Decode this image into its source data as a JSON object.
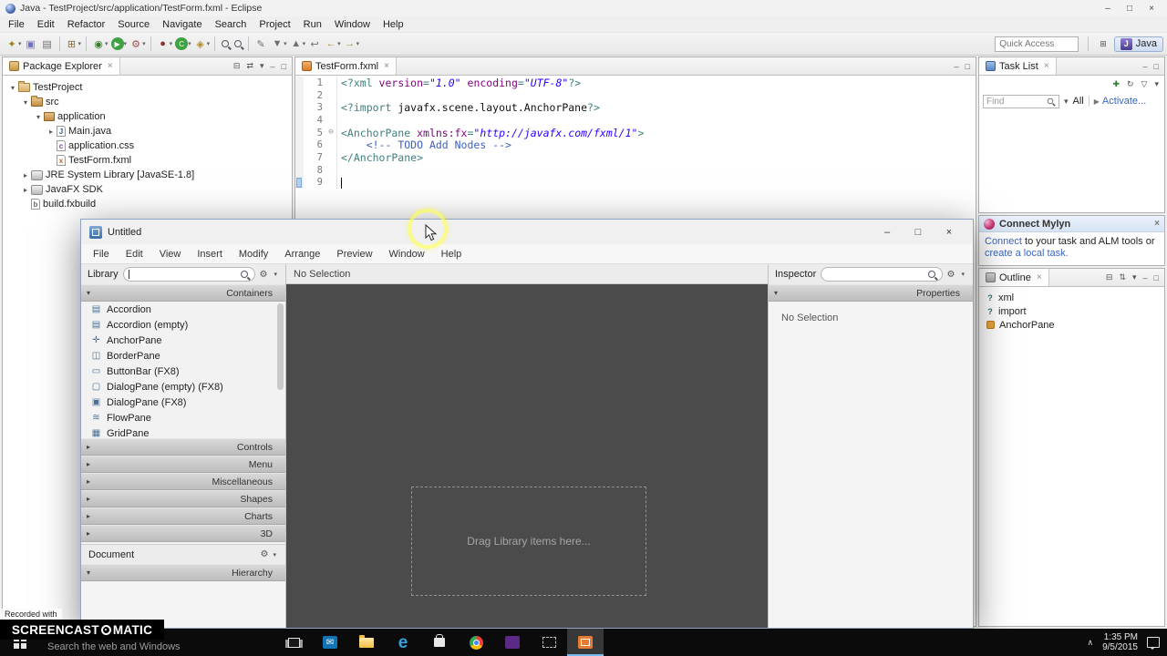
{
  "icons": {
    "close": "×",
    "minimize": "–",
    "maximize": "□",
    "chevron_down": "▾",
    "chevron_right": "▸",
    "chevron_up": "∧",
    "gear": "⚙",
    "grid": "⊞",
    "play_small": "▶",
    "fold_expanded": "⊖"
  },
  "eclipse": {
    "titlebar": {
      "title": "Java - TestProject/src/application/TestForm.fxml - Eclipse"
    },
    "menus": [
      "File",
      "Edit",
      "Refactor",
      "Source",
      "Navigate",
      "Search",
      "Project",
      "Run",
      "Window",
      "Help"
    ],
    "toolbar": {
      "quick_access": "Quick Access",
      "perspective_label": "Java",
      "perspective_icon_letter": "J",
      "icons": [
        {
          "name": "new-wizard",
          "glyph": "✦",
          "color": "#a07c10",
          "drop": true
        },
        {
          "name": "save",
          "glyph": "▣",
          "color": "#7070c8"
        },
        {
          "name": "print",
          "glyph": "▤",
          "color": "#707070"
        },
        {
          "sep": true
        },
        {
          "name": "new-java-project",
          "glyph": "⊞",
          "color": "#8a6d3b",
          "drop": true
        },
        {
          "sep": true
        },
        {
          "name": "debug",
          "glyph": "◉",
          "color": "#3a7d2c",
          "drop": true
        },
        {
          "name": "run",
          "glyph": "▶",
          "color": "#ffffff",
          "bg": "#3fa142",
          "drop": true
        },
        {
          "name": "external-tools",
          "glyph": "⚙",
          "color": "#9c5050",
          "drop": true
        },
        {
          "sep": true
        },
        {
          "name": "coverage",
          "glyph": "●",
          "color": "#8a3030",
          "drop": true
        },
        {
          "name": "new-class",
          "glyph": "C",
          "color": "#ffffff",
          "bg": "#3fa142",
          "drop": true
        },
        {
          "name": "new-package",
          "glyph": "◈",
          "color": "#b08d2f",
          "drop": true
        },
        {
          "sep": true
        },
        {
          "name": "open-type",
          "css": "mag"
        },
        {
          "name": "search",
          "css": "mag"
        },
        {
          "sep": true
        },
        {
          "name": "mark-occurrences",
          "glyph": "✎",
          "color": "#707070"
        },
        {
          "name": "next-annotation",
          "glyph": "▼",
          "color": "#707070",
          "drop": true
        },
        {
          "name": "previous-annotation",
          "glyph": "▲",
          "color": "#707070",
          "drop": true
        },
        {
          "name": "last-edit-location",
          "glyph": "↩",
          "color": "#707070"
        },
        {
          "name": "back",
          "glyph": "←",
          "color": "#b08d2f",
          "drop": true
        },
        {
          "name": "forward",
          "glyph": "→",
          "color": "#b08d2f",
          "drop": true
        }
      ]
    },
    "package_explorer": {
      "title": "Package Explorer",
      "header_icons": [
        {
          "name": "collapse-all",
          "glyph": "⊟",
          "color": "#555555"
        },
        {
          "name": "link-with-editor",
          "glyph": "⇄",
          "color": "#555555"
        },
        {
          "name": "view-menu",
          "glyph": "▾",
          "color": "#555555"
        },
        {
          "name": "minimize",
          "glyph": "–",
          "color": "#555555"
        },
        {
          "name": "maximize",
          "glyph": "□",
          "color": "#555555"
        }
      ],
      "icon_defs": {
        "project": {
          "shape": "folder",
          "letter": ""
        },
        "src": {
          "shape": "pkgfolder",
          "letter": ""
        },
        "pkg": {
          "shape": "pkg",
          "letter": ""
        },
        "java": {
          "shape": "file",
          "letter": "J",
          "color": "#2456a4"
        },
        "css": {
          "shape": "file",
          "letter": "c",
          "color": "#7a3db8"
        },
        "fxml": {
          "shape": "file",
          "letter": "x",
          "color": "#d2691e"
        },
        "lib": {
          "shape": "lib",
          "letter": ""
        },
        "build": {
          "shape": "file",
          "letter": "b",
          "color": "#666666"
        }
      },
      "tree": [
        {
          "label": "TestProject",
          "lvl": 0,
          "arrow": "expanded",
          "icon": "project"
        },
        {
          "label": "src",
          "lvl": 1,
          "arrow": "expanded",
          "icon": "src"
        },
        {
          "label": "application",
          "lvl": 2,
          "arrow": "expanded",
          "icon": "pkg"
        },
        {
          "label": "Main.java",
          "lvl": 3,
          "arrow": "collapsed",
          "icon": "java"
        },
        {
          "label": "application.css",
          "lvl": 3,
          "arrow": null,
          "icon": "css"
        },
        {
          "label": "TestForm.fxml",
          "lvl": 3,
          "arrow": null,
          "icon": "fxml"
        },
        {
          "label": "JRE System Library [JavaSE-1.8]",
          "lvl": 1,
          "arrow": "collapsed",
          "icon": "lib"
        },
        {
          "label": "JavaFX SDK",
          "lvl": 1,
          "arrow": "collapsed",
          "icon": "lib"
        },
        {
          "label": "build.fxbuild",
          "lvl": 1,
          "arrow": null,
          "icon": "build"
        }
      ]
    },
    "editor": {
      "tab": "TestForm.fxml",
      "header_icons": [
        {
          "name": "minimize",
          "glyph": "–",
          "color": "#555555"
        },
        {
          "name": "maximize",
          "glyph": "□",
          "color": "#555555"
        }
      ],
      "lines": [
        {
          "n": "1",
          "seg": [
            [
              "t",
              "<?xml "
            ],
            [
              "a",
              "version"
            ],
            [
              "t",
              "="
            ],
            [
              "s",
              "\"1.0\""
            ],
            [
              "p",
              " "
            ],
            [
              "a",
              "encoding"
            ],
            [
              "t",
              "="
            ],
            [
              "s",
              "\"UTF-8\""
            ],
            [
              "t",
              "?>"
            ]
          ]
        },
        {
          "n": "2",
          "seg": []
        },
        {
          "n": "3",
          "seg": [
            [
              "t",
              "<?import "
            ],
            [
              "p",
              "javafx.scene.layout.AnchorPane"
            ],
            [
              "t",
              "?>"
            ]
          ]
        },
        {
          "n": "4",
          "seg": []
        },
        {
          "n": "5",
          "fold": true,
          "seg": [
            [
              "t",
              "<AnchorPane "
            ],
            [
              "a",
              "xmlns:fx"
            ],
            [
              "t",
              "="
            ],
            [
              "s",
              "\"http://javafx.com/fxml/1\""
            ],
            [
              "t",
              ">"
            ]
          ]
        },
        {
          "n": "6",
          "seg": [
            [
              "p",
              "    "
            ],
            [
              "c",
              "<!-- TODO Add Nodes -->"
            ]
          ]
        },
        {
          "n": "7",
          "seg": [
            [
              "t",
              "</AnchorPane>"
            ]
          ]
        },
        {
          "n": "8",
          "seg": []
        },
        {
          "n": "9",
          "range": true,
          "caret": true,
          "seg": []
        }
      ]
    },
    "task_list": {
      "title": "Task List",
      "window_icons": [
        {
          "name": "minimize",
          "glyph": "–",
          "color": "#555555"
        },
        {
          "name": "maximize",
          "glyph": "□",
          "color": "#555555"
        }
      ],
      "toolbar_icons": [
        {
          "name": "new-task",
          "glyph": "✚",
          "color": "#2e7d32"
        },
        {
          "name": "synchronize",
          "glyph": "↻",
          "color": "#555555"
        },
        {
          "name": "filter",
          "glyph": "▽",
          "color": "#555555"
        },
        {
          "name": "view-menu",
          "glyph": "▾",
          "color": "#555555"
        }
      ],
      "find_label": "Find",
      "all_label": "All",
      "activate_label": "Activate..."
    },
    "mylyn": {
      "title": "Connect Mylyn",
      "link1": "Connect",
      "middle": " to your task and ALM tools or ",
      "link2": "create a local task."
    },
    "outline": {
      "title": "Outline",
      "header_icons": [
        {
          "name": "collapse-all",
          "glyph": "⊟",
          "color": "#555555"
        },
        {
          "name": "sort",
          "glyph": "⇅",
          "color": "#555555"
        },
        {
          "name": "view-menu",
          "glyph": "▾",
          "color": "#555555"
        },
        {
          "name": "minimize",
          "glyph": "–",
          "color": "#555555"
        },
        {
          "name": "maximize",
          "glyph": "□",
          "color": "#555555"
        }
      ],
      "icon_defs": {
        "decl": {
          "glyph": "?",
          "color": "#2f7070"
        },
        "element": {
          "glyph": "",
          "bg": "#e8a33d"
        }
      },
      "items": [
        {
          "label": "xml",
          "icon": "decl"
        },
        {
          "label": "import",
          "icon": "decl"
        },
        {
          "label": "AnchorPane",
          "icon": "element"
        }
      ]
    }
  },
  "scene_builder": {
    "title": "Untitled",
    "menus": [
      "File",
      "Edit",
      "View",
      "Insert",
      "Modify",
      "Arrange",
      "Preview",
      "Window",
      "Help"
    ],
    "library": {
      "title": "Library",
      "containers_label": "Containers",
      "items": [
        {
          "label": "Accordion",
          "icon": "▤"
        },
        {
          "label": "Accordion (empty)",
          "icon": "▤"
        },
        {
          "label": "AnchorPane",
          "icon": "✛"
        },
        {
          "label": "BorderPane",
          "icon": "◫"
        },
        {
          "label": "ButtonBar (FX8)",
          "icon": "▭"
        },
        {
          "label": "DialogPane (empty) (FX8)",
          "icon": "▢"
        },
        {
          "label": "DialogPane (FX8)",
          "icon": "▣"
        },
        {
          "label": "FlowPane",
          "icon": "≋"
        },
        {
          "label": "GridPane",
          "icon": "▦"
        }
      ],
      "collapsed_sections": [
        "Controls",
        "Menu",
        "Miscellaneous",
        "Shapes",
        "Charts",
        "3D"
      ],
      "document_label": "Document",
      "hierarchy_label": "Hierarchy"
    },
    "content": {
      "header": "No Selection",
      "placeholder": "Drag Library items here..."
    },
    "inspector": {
      "title": "Inspector",
      "section_label": "Properties",
      "empty_label": "No Selection"
    }
  },
  "taskbar": {
    "search_text": "Search the web and Windows",
    "apps": [
      {
        "name": "task-view",
        "type": "taskview"
      },
      {
        "name": "mail",
        "type": "boxglyph",
        "bg": "#1273b5",
        "glyph": "✉",
        "color": "#ffffff"
      },
      {
        "name": "file-explorer",
        "type": "folder"
      },
      {
        "name": "edge",
        "type": "textglyph",
        "glyph": "e",
        "color": "#35a3dc"
      },
      {
        "name": "store",
        "type": "store"
      },
      {
        "name": "chrome",
        "type": "chrome"
      },
      {
        "name": "app-purple",
        "type": "boxglyph",
        "bg": "#5b2a86",
        "glyph": "",
        "color": "#ffffff"
      },
      {
        "name": "command-prompt",
        "type": "cmd"
      },
      {
        "name": "scene-builder",
        "type": "sbapp",
        "active": true
      }
    ],
    "clock": {
      "time": "1:35 PM",
      "date": "9/5/2015"
    }
  },
  "watermark": {
    "prefix": "Recorded with",
    "brand_left": "SCREENCAST",
    "brand_right": "MATIC"
  }
}
